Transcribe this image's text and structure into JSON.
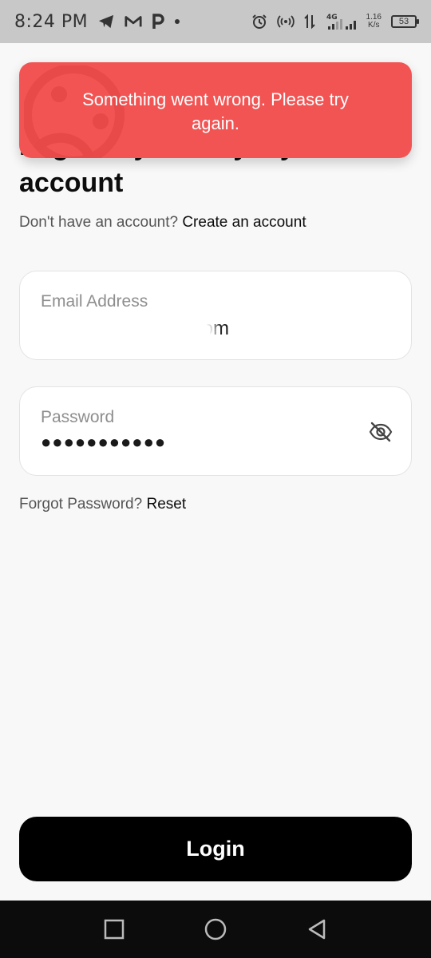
{
  "status_bar": {
    "time": "8:24 PM",
    "left_icons": [
      "telegram-icon",
      "gmail-icon",
      "p-app-icon",
      "dot-icon"
    ],
    "network": "4G",
    "speed_value": "1.16",
    "speed_unit": "K/s",
    "battery_level": "53"
  },
  "toast": {
    "message": "Something went wrong. Please try again.",
    "background_color": "#f25453"
  },
  "header": {
    "title": "Login to your Payday account",
    "subtitle_prefix": "Don't have an account?",
    "subtitle_link": "Create an account"
  },
  "form": {
    "email": {
      "label": "Email Address",
      "value_suffix": "ail.com"
    },
    "password": {
      "label": "Password",
      "value_masked": "●●●●●●●●●●●",
      "visibility_icon": "eye-off-icon"
    },
    "forgot_prefix": "Forgot Password?",
    "forgot_link": "Reset",
    "submit_label": "Login"
  },
  "nav": {
    "buttons": [
      "square-icon",
      "circle-icon",
      "triangle-back-icon"
    ]
  }
}
